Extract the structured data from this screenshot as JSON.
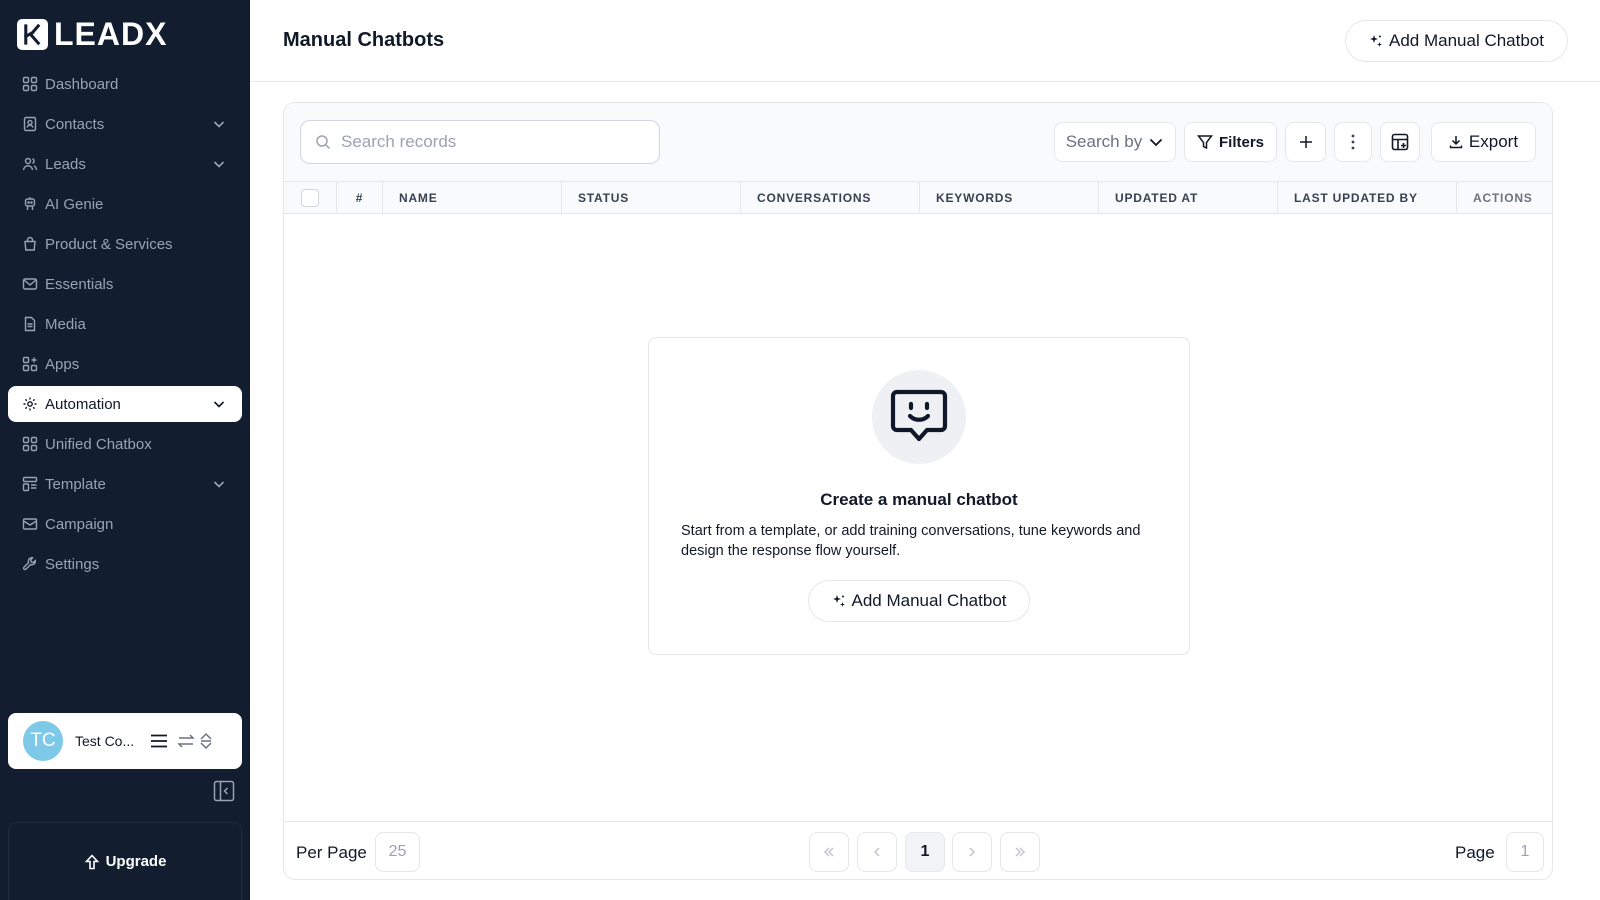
{
  "app": {
    "logo_text": "LEADX"
  },
  "sidebar": {
    "items": [
      {
        "label": "Dashboard",
        "icon": "grid-icon"
      },
      {
        "label": "Contacts",
        "icon": "contact-book-icon",
        "expandable": true
      },
      {
        "label": "Leads",
        "icon": "users-icon",
        "expandable": true
      },
      {
        "label": "AI Genie",
        "icon": "genie-icon"
      },
      {
        "label": "Product & Services",
        "icon": "shopping-bag-icon"
      },
      {
        "label": "Essentials",
        "icon": "mail-icon"
      },
      {
        "label": "Media",
        "icon": "file-icon"
      },
      {
        "label": "Apps",
        "icon": "apps-icon"
      },
      {
        "label": "Automation",
        "icon": "gear-icon",
        "expandable": true,
        "active": true
      },
      {
        "label": "Unified Chatbox",
        "icon": "grid-icon"
      },
      {
        "label": "Template",
        "icon": "template-icon",
        "expandable": true
      },
      {
        "label": "Campaign",
        "icon": "envelope-open-icon"
      },
      {
        "label": "Settings",
        "icon": "wrench-icon"
      }
    ],
    "user": {
      "initials": "TC",
      "name": "Test Co..."
    },
    "upgrade_label": "Upgrade"
  },
  "header": {
    "title": "Manual Chatbots",
    "add_button": "Add Manual Chatbot"
  },
  "toolbar": {
    "search_placeholder": "Search records",
    "search_by": "Search by",
    "filters": "Filters",
    "export": "Export"
  },
  "table": {
    "columns": [
      "#",
      "NAME",
      "STATUS",
      "CONVERSATIONS",
      "KEYWORDS",
      "UPDATED AT",
      "LAST UPDATED BY",
      "ACTIONS"
    ]
  },
  "empty_state": {
    "title": "Create a manual chatbot",
    "description": "Start from a template, or add training conversations, tune keywords and design the response flow yourself.",
    "button": "Add Manual Chatbot"
  },
  "pagination": {
    "per_page_label": "Per Page",
    "per_page_value": "25",
    "current_page": "1",
    "page_label": "Page",
    "page_value": "1"
  },
  "colors": {
    "sidebar_bg": "#121d2f",
    "avatar_bg": "#7ec8e8"
  }
}
